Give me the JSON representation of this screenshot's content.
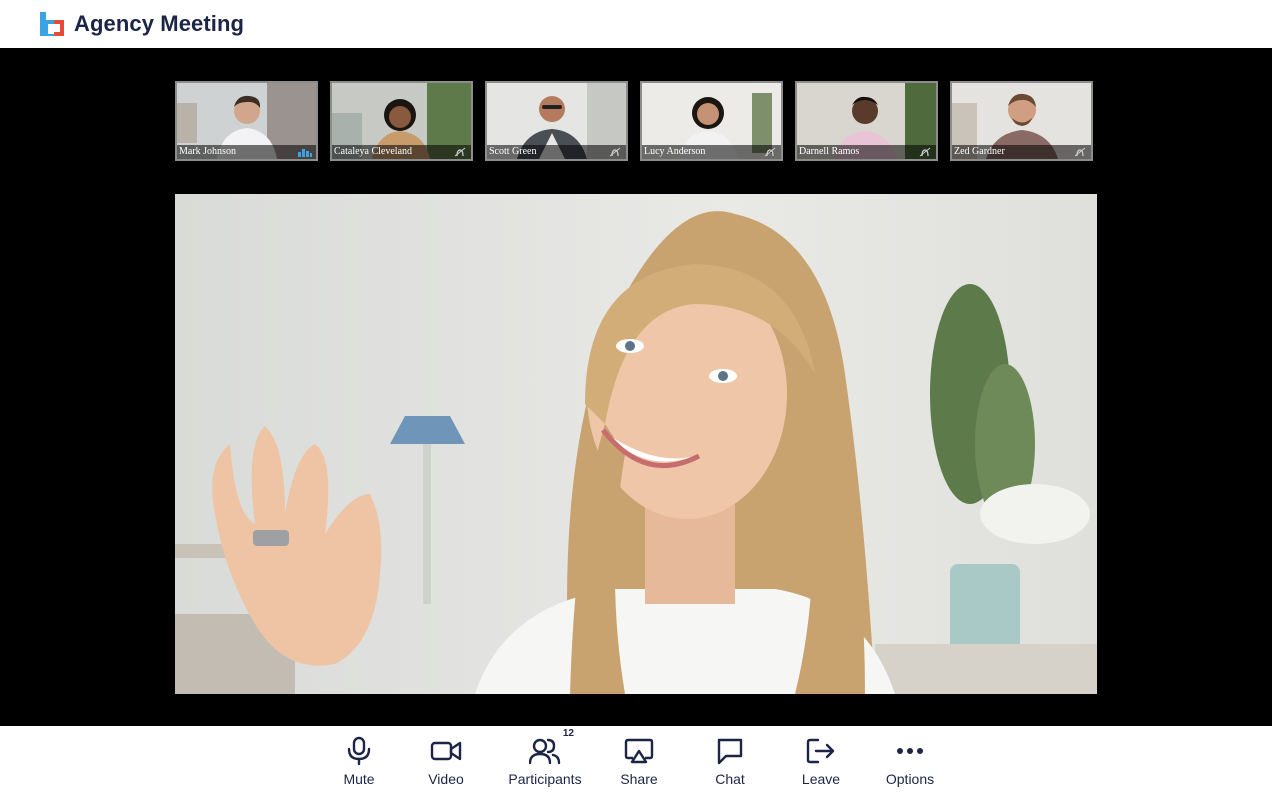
{
  "header": {
    "title": "Agency Meeting",
    "logo_icon": "agency-logo-icon",
    "colors": {
      "logo_blue": "#3aa3e3",
      "logo_red": "#e84a3a",
      "title": "#1c2546"
    }
  },
  "participants_strip": [
    {
      "name": "Mark Johnson",
      "indicator": "audio-level-icon"
    },
    {
      "name": "Cataleya Cleveland",
      "indicator": "mic-muted-icon"
    },
    {
      "name": "Scott Green",
      "indicator": "mic-muted-icon"
    },
    {
      "name": "Lucy Anderson",
      "indicator": "mic-muted-icon"
    },
    {
      "name": "Darnell Ramos",
      "indicator": "mic-muted-icon"
    },
    {
      "name": "Zed Gardner",
      "indicator": "mic-muted-icon"
    }
  ],
  "toolbar": {
    "mute_label": "Mute",
    "video_label": "Video",
    "participants_label": "Participants",
    "participants_count": "12",
    "share_label": "Share",
    "chat_label": "Chat",
    "leave_label": "Leave",
    "options_label": "Options",
    "icon_color": "#1c2546"
  }
}
